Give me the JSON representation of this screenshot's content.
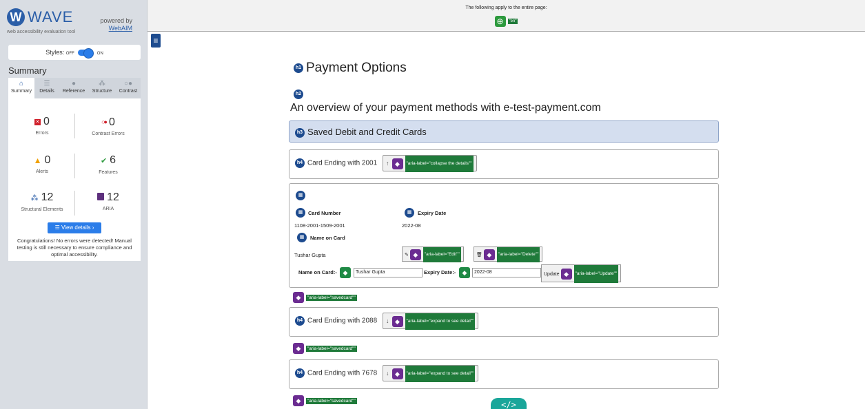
{
  "wave": {
    "logo_text": "WAVE",
    "logo_sub": "web accessibility evaluation tool",
    "powered_by": "powered by",
    "powered_link": "WebAIM",
    "styles_label": "Styles:",
    "styles_off": "OFF",
    "styles_on": "ON",
    "summary_title": "Summary",
    "tabs": [
      "Summary",
      "Details",
      "Reference",
      "Structure",
      "Contrast"
    ],
    "stats": {
      "errors": {
        "count": "0",
        "label": "Errors"
      },
      "contrast": {
        "count": "0",
        "label": "Contrast Errors"
      },
      "alerts": {
        "count": "0",
        "label": "Alerts"
      },
      "features": {
        "count": "6",
        "label": "Features"
      },
      "structural": {
        "count": "12",
        "label": "Structural Elements"
      },
      "aria": {
        "count": "12",
        "label": "ARIA"
      }
    },
    "view_details": "View details ›",
    "congrats": "Congratulations! No errors were detected! Manual testing is still necessary to ensure compliance and optimal accessibility."
  },
  "banner": {
    "text": "The following apply to the entire page:",
    "lang": "\"en\""
  },
  "page": {
    "h1": "Payment Options",
    "h2": "An overview of your payment methods with e-test-payment.com",
    "h3": "Saved Debit and Credit Cards",
    "cards": [
      {
        "title": "Card Ending with 2001",
        "arrow": "↑",
        "aria": "\"aria-label=\"collapse the details\"\""
      },
      {
        "title": "Card Ending with 2088",
        "arrow": "↓",
        "aria": "\"aria-label=\"expand to see detail\"\""
      },
      {
        "title": "Card Ending with 7678",
        "arrow": "↓",
        "aria": "\"aria-label=\"expand to see detail\"\""
      }
    ],
    "detail": {
      "card_number_label": "Card Number",
      "card_number_value": "1108-2001-1509-2001",
      "expiry_label": "Expiry Date",
      "expiry_value": "2022-08",
      "name_label": "Name on Card",
      "name_value": "Tushar Gupta",
      "edit_aria": "\"aria-label=\"Edit\"\"",
      "delete_aria": "\"aria-label=\"Delete\"\"",
      "form_name_label": "Name on Card:-",
      "form_name_value": "Tushar Gupta",
      "form_expiry_label": "Expiry Date:-",
      "form_expiry_value": "2022-08",
      "update_label": "Update",
      "update_aria": "\"aria-label=\"Update\"\""
    },
    "savedcard_aria": "\"aria-label=\"savedcard\"\"",
    "heading_badges": {
      "h1": "h1",
      "h2": "h2",
      "h3": "h3",
      "h4": "h4"
    }
  }
}
